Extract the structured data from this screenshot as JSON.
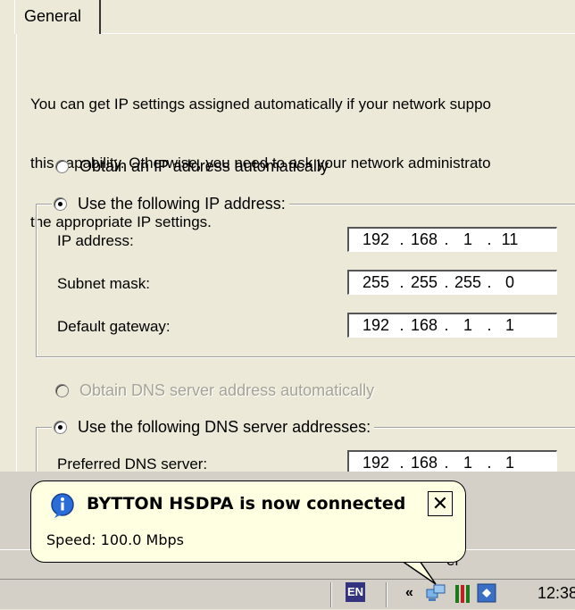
{
  "tab": {
    "label": "General"
  },
  "intro": {
    "lines": [
      "You can get IP settings assigned automatically if your network suppo",
      "this capability. Otherwise, you need to ask your network administrato",
      "the appropriate IP settings."
    ]
  },
  "ip_mode": {
    "auto_label": "Obtain an IP address automatically",
    "manual_label": "Use the following IP address:",
    "selected": "manual"
  },
  "ip_fields": [
    {
      "label": "IP address:",
      "octets": [
        "192",
        "168",
        "1",
        "11"
      ]
    },
    {
      "label": "Subnet mask:",
      "octets": [
        "255",
        "255",
        "255",
        "0"
      ]
    },
    {
      "label": "Default gateway:",
      "octets": [
        "192",
        "168",
        "1",
        "1"
      ]
    }
  ],
  "dns_mode": {
    "auto_label": "Obtain DNS server address automatically",
    "manual_label": "Use the following DNS server addresses:",
    "selected": "manual"
  },
  "dns_fields": [
    {
      "label": "Preferred DNS server:",
      "octets": [
        "192",
        "168",
        "1",
        "1"
      ]
    }
  ],
  "balloon": {
    "icon": "info-icon",
    "title": "BYTTON HSDPA is now connected",
    "body": "Speed: 100.0 Mbps",
    "close_icon": "close-icon"
  },
  "behind_balloon_text": "er",
  "taskbar": {
    "language": "EN",
    "chevron": "«",
    "clock": "12:38",
    "tray_icons": [
      "network-icon",
      "volume-meter-icon",
      "app-icon"
    ]
  }
}
